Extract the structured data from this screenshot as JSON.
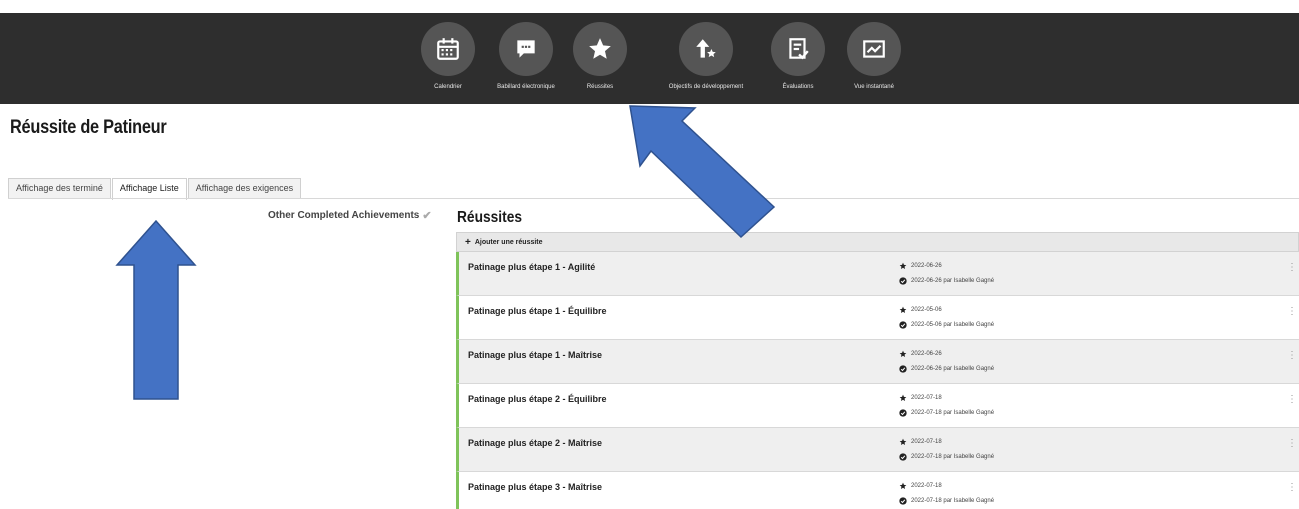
{
  "nav": {
    "items": [
      {
        "label": "Calendrier",
        "icon": "calendar-icon"
      },
      {
        "label": "Babillard électronique",
        "icon": "message-board-icon"
      },
      {
        "label": "Réussites",
        "icon": "star-icon"
      },
      {
        "label": "Objectifs de développement",
        "icon": "arrow-up-star-icon"
      },
      {
        "label": "Évaluations",
        "icon": "evaluation-icon"
      },
      {
        "label": "Vue instantané",
        "icon": "chart-icon"
      }
    ]
  },
  "page": {
    "title": "Réussite de Patineur"
  },
  "tabs": [
    {
      "label": "Affichage des terminé",
      "active": false
    },
    {
      "label": "Affichage Liste",
      "active": true
    },
    {
      "label": "Affichage des exigences",
      "active": false
    }
  ],
  "sidebar": {
    "other_completed": "Other Completed Achievements"
  },
  "achievements": {
    "title": "Réussites",
    "add_label": "Ajouter une réussite",
    "items": [
      {
        "name": "Patinage plus étape 1 - Agilité",
        "date": "2022-06-26",
        "completed": "2022-06-26 par Isabelle Gagné"
      },
      {
        "name": "Patinage plus étape 1 - Équilibre",
        "date": "2022-05-06",
        "completed": "2022-05-06 par Isabelle Gagné"
      },
      {
        "name": "Patinage plus étape 1 - Maîtrise",
        "date": "2022-06-26",
        "completed": "2022-06-26 par Isabelle Gagné"
      },
      {
        "name": "Patinage plus étape 2 - Équilibre",
        "date": "2022-07-18",
        "completed": "2022-07-18 par Isabelle Gagné"
      },
      {
        "name": "Patinage plus étape 2 - Maîtrise",
        "date": "2022-07-18",
        "completed": "2022-07-18 par Isabelle Gagné"
      },
      {
        "name": "Patinage plus étape 3 - Maîtrise",
        "date": "2022-07-18",
        "completed": "2022-07-18 par Isabelle Gagné"
      }
    ]
  },
  "colors": {
    "topbar": "#2e2e2e",
    "nav_circle": "#555555",
    "accent_green": "#7fc35a",
    "annotation_arrow": "#4472c4"
  }
}
